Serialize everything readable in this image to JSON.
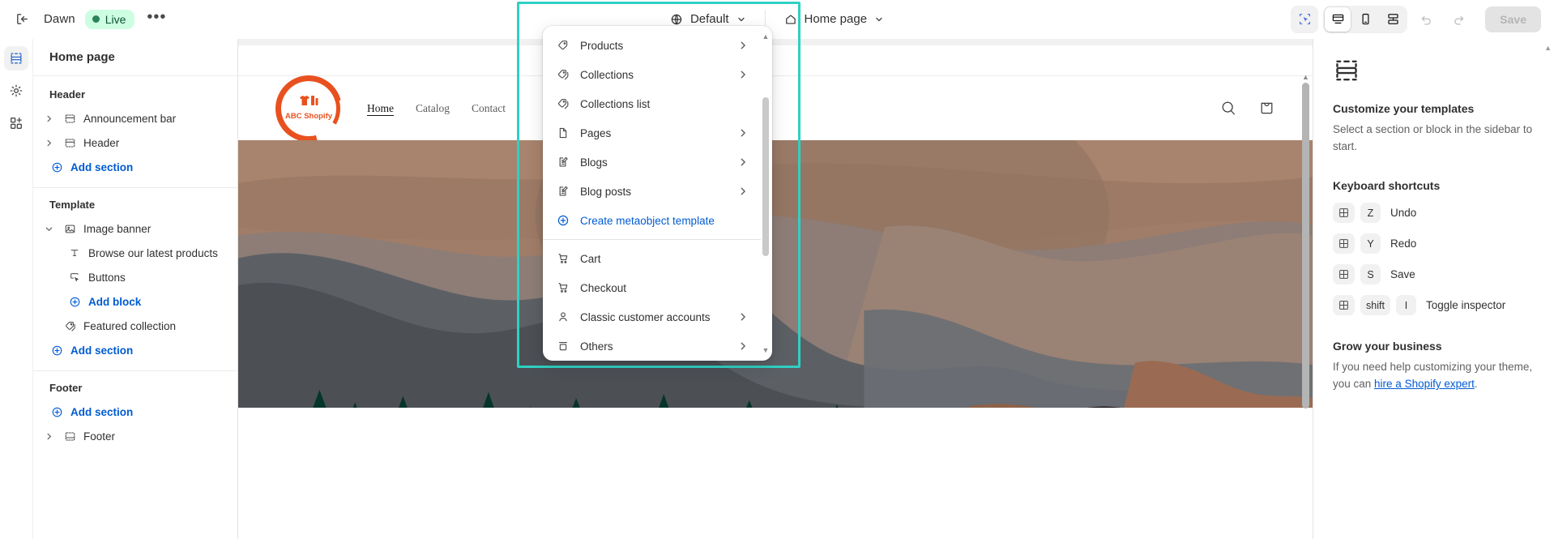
{
  "topbar": {
    "exit_icon": "exit-icon",
    "theme_name": "Dawn",
    "status_badge": "Live",
    "more_label": "•••",
    "locale_selector": {
      "icon": "globe-icon",
      "label": "Default"
    },
    "page_selector": {
      "icon": "home-icon",
      "label": "Home page"
    },
    "tools": {
      "select_tool": "select-tool-icon",
      "desktop": "desktop-icon",
      "mobile": "mobile-icon",
      "fullscreen": "fullscreen-icon",
      "undo": "undo-icon",
      "redo": "redo-icon",
      "save_label": "Save"
    }
  },
  "rail": {
    "items": [
      {
        "name": "sections-icon",
        "active": true
      },
      {
        "name": "settings-gear-icon",
        "active": false
      },
      {
        "name": "apps-icon",
        "active": false
      }
    ]
  },
  "sidebar": {
    "title": "Home page",
    "groups": [
      {
        "label": "Header",
        "rows": [
          {
            "label": "Announcement bar",
            "icon": "section-icon",
            "chevron": "right",
            "kind": "section"
          },
          {
            "label": "Header",
            "icon": "section-icon",
            "chevron": "right",
            "kind": "section"
          },
          {
            "label": "Add section",
            "icon": "plus-circle-icon",
            "kind": "add"
          }
        ]
      },
      {
        "label": "Template",
        "rows": [
          {
            "label": "Image banner",
            "icon": "image-icon",
            "chevron": "down",
            "kind": "section"
          },
          {
            "label": "Browse our latest products",
            "icon": "text-icon",
            "kind": "block"
          },
          {
            "label": "Buttons",
            "icon": "button-icon",
            "kind": "block"
          },
          {
            "label": "Add block",
            "icon": "plus-circle-icon",
            "kind": "add-block"
          },
          {
            "label": "Featured collection",
            "icon": "collection-tag-icon",
            "kind": "section-noexpand"
          },
          {
            "label": "Add section",
            "icon": "plus-circle-icon",
            "kind": "add"
          }
        ]
      },
      {
        "label": "Footer",
        "rows": [
          {
            "label": "Add section",
            "icon": "plus-circle-icon",
            "kind": "add"
          },
          {
            "label": "Footer",
            "icon": "section-icon",
            "chevron": "right",
            "kind": "section"
          }
        ]
      }
    ]
  },
  "dropdown": {
    "items": [
      {
        "label": "Products",
        "icon": "tag-icon",
        "arrow": true
      },
      {
        "label": "Collections",
        "icon": "collection-tag-icon",
        "arrow": true
      },
      {
        "label": "Collections list",
        "icon": "collection-tag-icon",
        "arrow": false
      },
      {
        "label": "Pages",
        "icon": "page-icon",
        "arrow": true
      },
      {
        "label": "Blogs",
        "icon": "blog-icon",
        "arrow": true
      },
      {
        "label": "Blog posts",
        "icon": "blog-icon",
        "arrow": true
      },
      {
        "label": "Create metaobject template",
        "icon": "plus-circle-icon",
        "arrow": false,
        "accent": true
      },
      {
        "separator": true
      },
      {
        "label": "Cart",
        "icon": "cart-icon",
        "arrow": false
      },
      {
        "label": "Checkout",
        "icon": "cart-icon",
        "arrow": false
      },
      {
        "label": "Classic customer accounts",
        "icon": "person-icon",
        "arrow": true
      },
      {
        "label": "Others",
        "icon": "others-icon",
        "arrow": true
      }
    ]
  },
  "preview": {
    "store_name": "ABC Shopify",
    "nav": [
      {
        "label": "Home",
        "active": true
      },
      {
        "label": "Catalog",
        "active": false
      },
      {
        "label": "Contact",
        "active": false
      }
    ],
    "actions": [
      {
        "name": "search-icon"
      },
      {
        "name": "shopping-bag-icon"
      }
    ],
    "brand_color": "#e8511f"
  },
  "inspector": {
    "icon": "section-placeholder-icon",
    "title": "Customize your templates",
    "description": "Select a section or block in the sidebar to start.",
    "shortcuts_title": "Keyboard shortcuts",
    "shortcuts": [
      {
        "keys": [
          "⌘",
          "Z"
        ],
        "label": "Undo"
      },
      {
        "keys": [
          "⌘",
          "Y"
        ],
        "label": "Redo"
      },
      {
        "keys": [
          "⌘",
          "S"
        ],
        "label": "Save"
      },
      {
        "keys": [
          "⌘",
          "shift",
          "I"
        ],
        "label": "Toggle inspector"
      }
    ],
    "grow_title": "Grow your business",
    "grow_text_before": "If you need help customizing your theme, you can ",
    "grow_link": "hire a Shopify expert",
    "grow_text_after": "."
  },
  "colors": {
    "highlight": "#2fd0c4",
    "accent_blue": "#005bd3",
    "live_bg": "#cdfee1",
    "live_text": "#0c5132"
  }
}
